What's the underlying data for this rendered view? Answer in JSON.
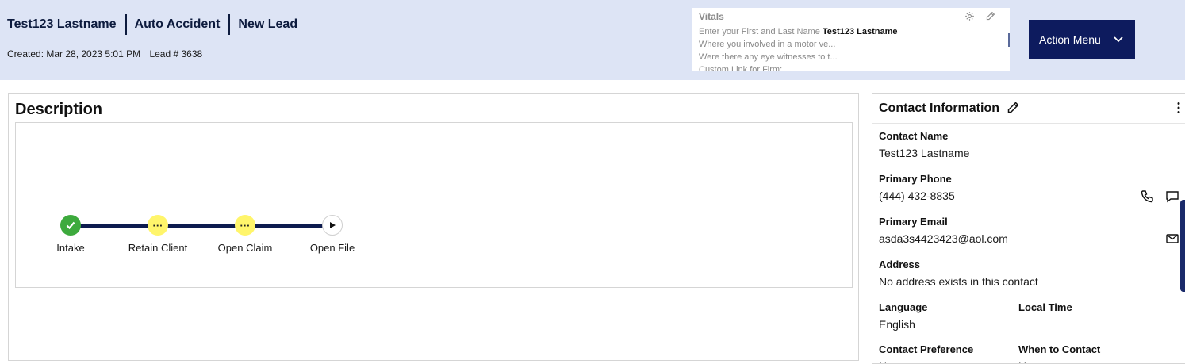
{
  "header": {
    "name": "Test123 Lastname",
    "case_type": "Auto Accident",
    "status": "New Lead",
    "created": "Created: Mar 28, 2023 5:01 PM",
    "lead": "Lead # 3638"
  },
  "vitals": {
    "title": "Vitals",
    "line1_label": "Enter your First and Last Name",
    "line1_value": "Test123 Lastname",
    "line2": "Where you involved in a motor ve...",
    "line3": "Were there any eye witnesses to t...",
    "line4": "Custom Link for Firm:"
  },
  "action_menu": {
    "label": "Action Menu"
  },
  "description": {
    "title": "Description"
  },
  "tracker": {
    "steps": [
      {
        "label": "Intake",
        "state": "done"
      },
      {
        "label": "Retain Client",
        "state": "pending"
      },
      {
        "label": "Open Claim",
        "state": "pending"
      },
      {
        "label": "Open File",
        "state": "play"
      }
    ]
  },
  "contact": {
    "title": "Contact Information",
    "name_label": "Contact Name",
    "name_value": "Test123 Lastname",
    "phone_label": "Primary Phone",
    "phone_value": "(444) 432-8835",
    "email_label": "Primary Email",
    "email_value": "asda3s4423423@aol.com",
    "address_label": "Address",
    "address_value": "No address exists in this contact",
    "language_label": "Language",
    "language_value": "English",
    "localtime_label": "Local Time",
    "pref_label": "Contact Preference",
    "when_label": "When to Contact",
    "pref_value": "N",
    "when_value": "U"
  },
  "colors": {
    "header_bg": "#dde4f5",
    "navy": "#0d1b5e",
    "done": "#3daa3d",
    "pending": "#fff56b"
  }
}
